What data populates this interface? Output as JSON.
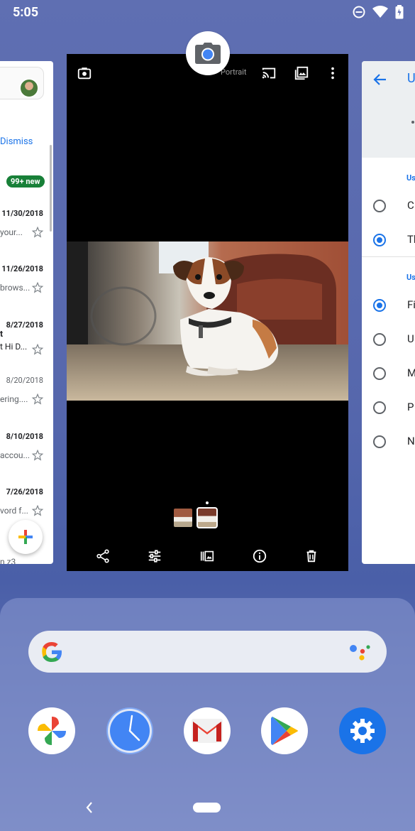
{
  "status_bar": {
    "time": "5:05"
  },
  "gmail_card": {
    "dismiss": "Dismiss",
    "badge": "99+ new",
    "items": [
      {
        "date": "11/30/2018",
        "snippet": "your..."
      },
      {
        "date": "11/26/2018",
        "snippet": "brows..."
      },
      {
        "date": "8/27/2018",
        "top": "t",
        "snippet": "t Hi D..."
      },
      {
        "date": "8/20/2018",
        "snippet": "ering...."
      },
      {
        "date": "8/10/2018",
        "snippet": "accou..."
      },
      {
        "date": "7/26/2018",
        "snippet": "vord f..."
      }
    ],
    "bottom_snippet": "n z3"
  },
  "camera_card": {
    "portrait_label": "Portrait"
  },
  "settings_card": {
    "title": "U",
    "section1": "Us",
    "row_c": "C",
    "row_t": "Th",
    "section2": "Us",
    "row_fi": "Fi",
    "row_u": "U",
    "row_m": "M",
    "row_p": "P",
    "row_n": "N"
  },
  "colors": {
    "accent": "#1a73e8",
    "gmail_badge": "#188038"
  }
}
